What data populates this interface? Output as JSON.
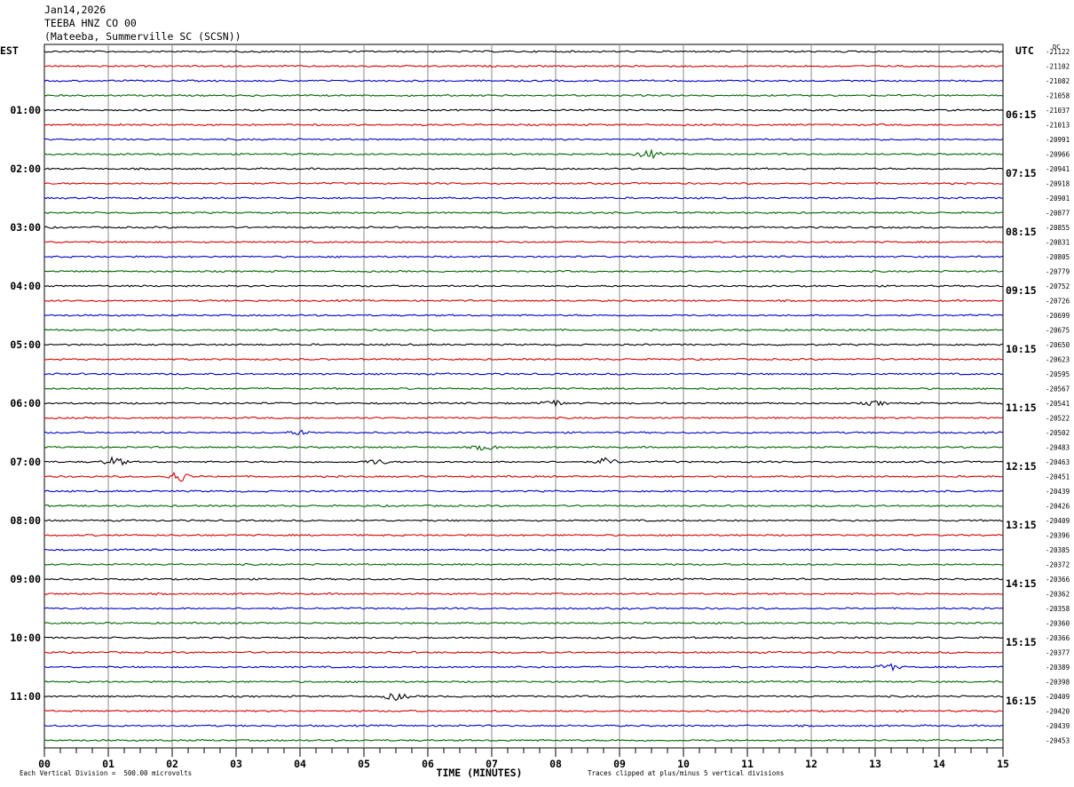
{
  "header": {
    "date": "Jan14,2026",
    "station": "TEEBA HNZ CO 00",
    "location": "(Mateeba, Summerville SC (SCSN))"
  },
  "left_tz": "EST",
  "right_tz": "UTC",
  "dc_label": "DC",
  "footer": {
    "scale_note": "Each Vertical Division =  500.00 microvolts",
    "clip_note": "Traces clipped at plus/minus 5 vertical divisions"
  },
  "chart_data": {
    "type": "line",
    "xlabel": "TIME (MINUTES)",
    "xlim": [
      0,
      15
    ],
    "x_ticks": [
      "00",
      "01",
      "02",
      "03",
      "04",
      "05",
      "06",
      "07",
      "08",
      "09",
      "10",
      "11",
      "12",
      "13",
      "14",
      "15"
    ],
    "trace_colors": [
      "#000000",
      "#d40000",
      "#0000c8",
      "#006400"
    ],
    "est_hour_labels": [
      "01:00",
      "02:00",
      "03:00",
      "04:00",
      "05:00",
      "06:00",
      "07:00",
      "08:00",
      "09:00",
      "10:00",
      "11:00"
    ],
    "utc_hour_labels": [
      "06:15",
      "07:15",
      "08:15",
      "09:15",
      "10:15",
      "11:15",
      "12:15",
      "13:15",
      "14:15",
      "15:15",
      "16:15"
    ],
    "dc_offsets": [
      "-21122",
      "-21102",
      "-21082",
      "-21058",
      "-21037",
      "-21013",
      "-20991",
      "-20966",
      "-20941",
      "-20918",
      "-20901",
      "-20877",
      "-20855",
      "-20831",
      "-20805",
      "-20779",
      "-20752",
      "-20726",
      "-20699",
      "-20675",
      "-20650",
      "-20623",
      "-20595",
      "-20567",
      "-20541",
      "-20522",
      "-20502",
      "-20483",
      "-20463",
      "-20451",
      "-20439",
      "-20426",
      "-20409",
      "-20396",
      "-20385",
      "-20372",
      "-20366",
      "-20362",
      "-20358",
      "-20360",
      "-20366",
      "-20377",
      "-20389",
      "-20398",
      "-20409",
      "-20420",
      "-20439",
      "-20453"
    ],
    "events": [
      {
        "trace": 7,
        "minute": 9.45,
        "amplitude": 1.2
      },
      {
        "trace": 24,
        "minute": 7.95,
        "amplitude": 1.0
      },
      {
        "trace": 24,
        "minute": 13.0,
        "amplitude": 0.6
      },
      {
        "trace": 26,
        "minute": 4.0,
        "amplitude": 0.6
      },
      {
        "trace": 27,
        "minute": 6.9,
        "amplitude": 0.8
      },
      {
        "trace": 28,
        "minute": 1.1,
        "amplitude": 1.3
      },
      {
        "trace": 28,
        "minute": 5.2,
        "amplitude": 0.8
      },
      {
        "trace": 28,
        "minute": 8.8,
        "amplitude": 1.0
      },
      {
        "trace": 29,
        "minute": 2.1,
        "amplitude": 1.6
      },
      {
        "trace": 42,
        "minute": 13.2,
        "amplitude": 1.0
      },
      {
        "trace": 44,
        "minute": 5.5,
        "amplitude": 1.0
      }
    ]
  }
}
